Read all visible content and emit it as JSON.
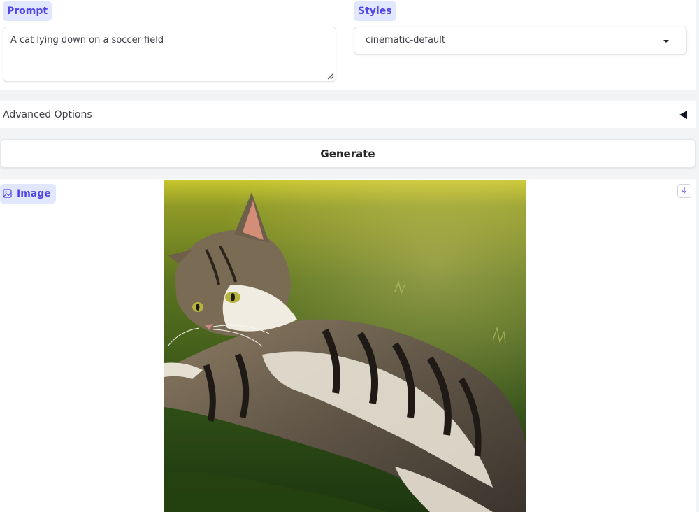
{
  "prompt": {
    "label": "Prompt",
    "value": "A cat lying down on a soccer field"
  },
  "styles": {
    "label": "Styles",
    "selected": "cinematic-default"
  },
  "advanced": {
    "label": "Advanced Options"
  },
  "generate": {
    "label": "Generate"
  },
  "output": {
    "label": "Image",
    "icons": {
      "label_icon": "image-icon",
      "download": "download-icon"
    }
  },
  "colors": {
    "accent": "#4f46e5",
    "chip_bg": "#e0e7ff",
    "page_bg": "#f3f4f6",
    "panel_bg": "#ffffff"
  }
}
